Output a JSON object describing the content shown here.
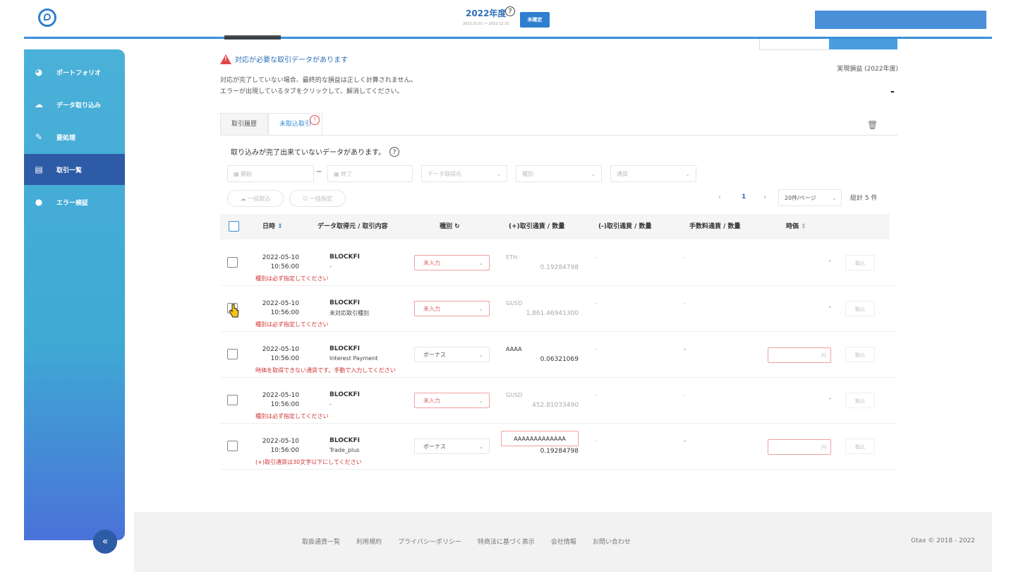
{
  "topbar": {
    "year_title": "2022年度",
    "year_range": "2022.01.01 ～ 2022.12.31",
    "status_badge": "未確定"
  },
  "sidebar": {
    "items": [
      {
        "label": "ポートフォリオ",
        "icon": "pie-chart-icon"
      },
      {
        "label": "データ取り込み",
        "icon": "cloud-upload-icon"
      },
      {
        "label": "要処理",
        "icon": "edit-icon"
      },
      {
        "label": "取引一覧",
        "icon": "list-icon",
        "active": true
      },
      {
        "label": "エラー検証",
        "icon": "alert-circle-icon"
      }
    ],
    "collapse_label": "«"
  },
  "summary": {
    "realized_label": "実現損益 (2022年度)",
    "realized_value": "-"
  },
  "alert": {
    "title": "対応が必要な取引データがあります",
    "description": "対応が完了していない場合、最終的な損益は正しく計算されません。\nエラーが出現しているタブをクリックして、解消してください。"
  },
  "tabs": [
    {
      "label": "取引履歴",
      "active": false
    },
    {
      "label": "未取込取引",
      "active": true,
      "badge": "!"
    }
  ],
  "section_note": "取り込みが完了出来ていないデータがあります。",
  "filters": {
    "start_placeholder": "開始",
    "end_placeholder": "終了",
    "tilde": "~",
    "source_placeholder": "データ取得元",
    "type_placeholder": "種別",
    "currency_placeholder": "通貨"
  },
  "actions": {
    "bulk_import": "一括取込",
    "bulk_specify": "一括指定"
  },
  "pagination": {
    "prev": "‹",
    "current": "1",
    "next": "›",
    "page_size": "20件/ページ",
    "total": "総計 5 件"
  },
  "table": {
    "headers": {
      "datetime": "日時",
      "source": "データ取得元 / 取引内容",
      "type": "種別",
      "plus_currency": "(+)取引通貨 / 数量",
      "minus_currency": "(-)取引通貨 / 数量",
      "fee_currency": "手数料通貨 / 数量",
      "price": "時価"
    },
    "rows": [
      {
        "date": "2022-05-10",
        "time": "10:56:00",
        "source": "BLOCKFI",
        "desc": "-",
        "type": "未入力",
        "plus_cur": "ETH",
        "plus_amt": "0.19284798",
        "minus": "-",
        "fee": "-",
        "price": "-",
        "import": "取込",
        "error": "種別は必ず指定してください"
      },
      {
        "date": "2022-05-10",
        "time": "10:56:00",
        "source": "BLOCKFI",
        "desc": "未対応取引種別",
        "type": "未入力",
        "plus_cur": "GUSD",
        "plus_amt": "1,861.46941300",
        "minus": "-",
        "fee": "-",
        "price": "-",
        "import": "取込",
        "error": "種別は必ず指定してください"
      },
      {
        "date": "2022-05-10",
        "time": "10:56:00",
        "source": "BLOCKFI",
        "desc": "Interest Payment",
        "type": "ボーナス",
        "plus_cur": "AAAA",
        "plus_amt": "0.06321069",
        "minus": "-",
        "fee": "-",
        "price_unit": "円",
        "import": "取込",
        "error": "時価を取得できない通貨です。手動で入力してください"
      },
      {
        "date": "2022-05-10",
        "time": "10:56:00",
        "source": "BLOCKFI",
        "desc": "-",
        "type": "未入力",
        "plus_cur": "GUSD",
        "plus_amt": "452.81033490",
        "minus": "-",
        "fee": "-",
        "price": "-",
        "import": "取込",
        "error": "種別は必ず指定してください"
      },
      {
        "date": "2022-05-10",
        "time": "10:56:00",
        "source": "BLOCKFI",
        "desc": "Trade_plus",
        "type": "ボーナス",
        "plus_cur": "AAAAAAAAAAAAA",
        "plus_amt": "0.19284798",
        "minus": "-",
        "fee": "-",
        "price_unit": "円",
        "import": "取込",
        "error": "(+)取引通貨は30文字以下にしてください"
      }
    ]
  },
  "footer": {
    "links": [
      "取扱通貨一覧",
      "利用規約",
      "プライバシーポリシー",
      "特商法に基づく表示",
      "会社情報",
      "お問い合わせ"
    ],
    "copyright": "Gtax © 2018 - 2022"
  },
  "colors": {
    "accent": "#3a8fd8",
    "sidebar_active": "#2d5ba5",
    "error": "#d23232"
  }
}
